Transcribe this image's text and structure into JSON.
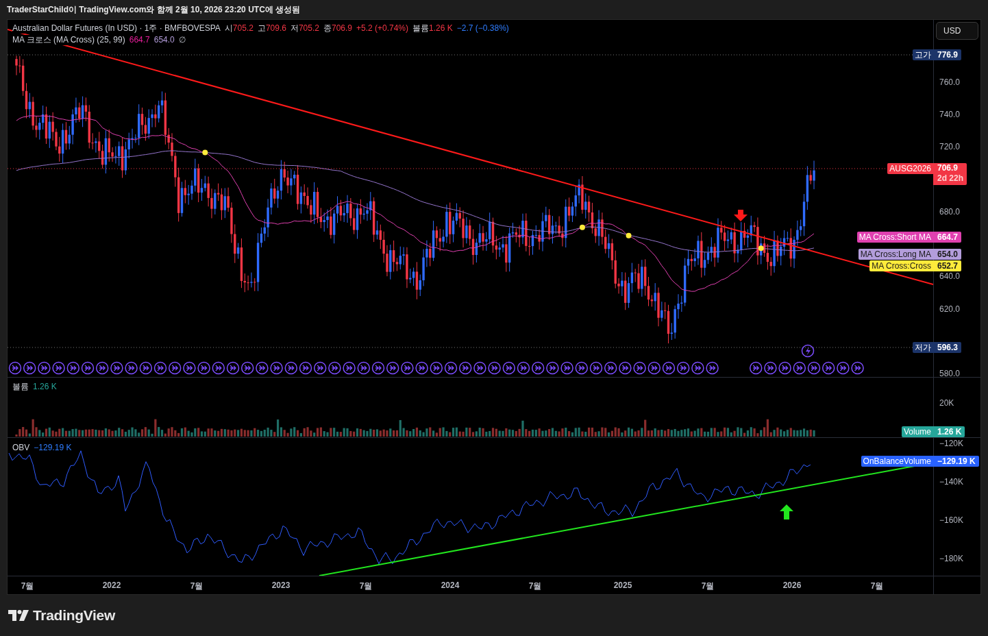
{
  "header": {
    "caption": "TraderStarChild이 TradingView.com와 함께 2월 10, 2026 23:20 UTC에 생성됨"
  },
  "main_pane": {
    "legend": {
      "title": "Australian Dollar Futures (In USD) · 1주 · BMFBOVESPA",
      "ohlc": [
        {
          "label": "시",
          "value": "705.2"
        },
        {
          "label": "고",
          "value": "709.6"
        },
        {
          "label": "저",
          "value": "705.2"
        },
        {
          "label": "종",
          "value": "706.9"
        }
      ],
      "change": "+5.2 (+0.74%)",
      "volume_label": "볼륨",
      "volume_value": "1.26 K",
      "volume_change": "−2.7 (−0.38%)"
    },
    "indicator": {
      "name": "MA 크로스 (MA Cross) (25, 99)",
      "values": [
        {
          "text": "664.7",
          "color": "#e91e9c"
        },
        {
          "text": "654.0",
          "color": "#b39ddb"
        }
      ],
      "status": "∅"
    },
    "currency": "USD",
    "axis_labels": [
      "760.0",
      "740.0",
      "720.0",
      "680.0",
      "640.0",
      "620.0",
      "580.0"
    ],
    "tags": [
      {
        "kind": "extreme",
        "label": "고가",
        "value": "776.9"
      },
      {
        "kind": "last",
        "label": "AUSG2026",
        "value": "706.9",
        "countdown": "2d 22h"
      },
      {
        "kind": "series",
        "label": "MA Cross:Short MA",
        "value": "664.7",
        "color": "#e040b0"
      },
      {
        "kind": "series",
        "label": "MA Cross:Long MA",
        "value": "654.0",
        "color": "#b39ddb"
      },
      {
        "kind": "series",
        "label": "MA Cross:Cross",
        "value": "652.7",
        "color": "#ffeb3b"
      },
      {
        "kind": "extreme",
        "label": "저가",
        "value": "596.3"
      }
    ]
  },
  "volume_pane": {
    "legend_label": "볼륨",
    "legend_value": "1.26 K",
    "axis_labels": [
      "20K"
    ],
    "tag": {
      "label": "Volume",
      "value": "1.26 K"
    }
  },
  "obv_pane": {
    "legend_label": "OBV",
    "legend_value": "−129.19 K",
    "axis_labels": [
      "−120K",
      "−140K",
      "−160K",
      "−180K"
    ],
    "tag": {
      "label": "OnBalanceVolume",
      "value": "−129.19 K"
    }
  },
  "time_axis": [
    "7월",
    "2022",
    "7월",
    "2023",
    "7월",
    "2024",
    "7월",
    "2025",
    "7월",
    "2026",
    "7월"
  ],
  "logo": "TradingView"
}
